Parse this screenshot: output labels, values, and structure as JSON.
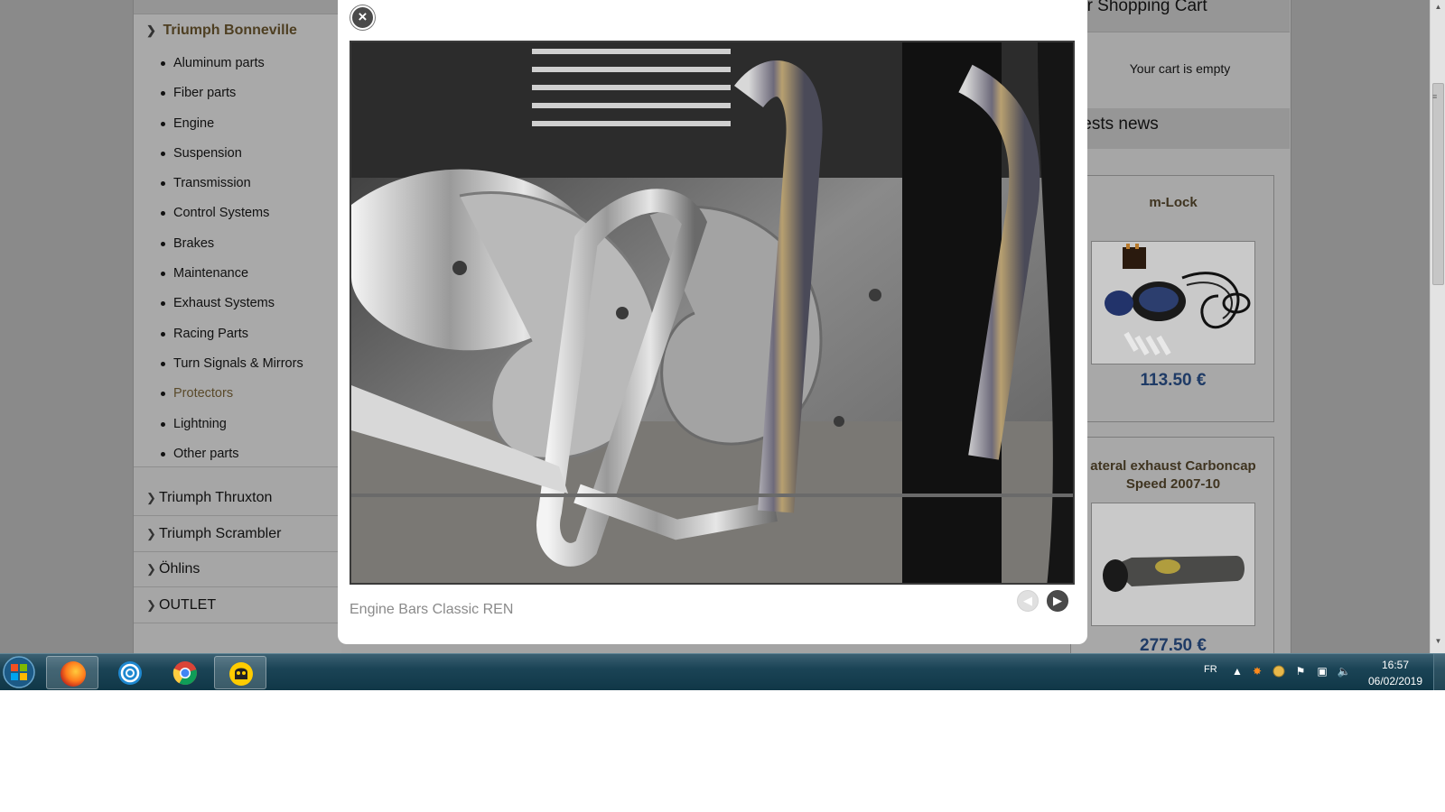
{
  "sidebar": {
    "active_category": "Triumph Bonneville",
    "subcategories": [
      "Aluminum parts",
      "Fiber parts",
      "Engine",
      "Suspension",
      "Transmission",
      "Control Systems",
      "Brakes",
      "Maintenance",
      "Exhaust Systems",
      "Racing Parts",
      "Turn Signals & Mirrors",
      "Protectors",
      "Lightning",
      "Other parts"
    ],
    "active_subcategory": "Protectors",
    "other_categories": [
      "Triumph Thruxton",
      "Triumph Scrambler",
      "Öhlins",
      "OUTLET"
    ]
  },
  "cart": {
    "title": "ur Shopping Cart",
    "empty_text": "Your cart is empty"
  },
  "news": {
    "title": "tests news",
    "products": [
      {
        "name": "m-Lock",
        "price": "113.50 €"
      },
      {
        "name": "ateral exhaust Carboncap Speed 2007-10",
        "price": "277.50 €"
      }
    ]
  },
  "lightbox": {
    "caption": "Engine Bars Classic REN",
    "close_icon": "close-icon",
    "prev_icon": "prev-arrow-icon",
    "next_icon": "next-arrow-icon"
  },
  "taskbar": {
    "apps": [
      "Firefox",
      "Uplay",
      "Chrome",
      "CyberGhost"
    ],
    "language": "FR",
    "time": "16:57",
    "date": "06/02/2019"
  },
  "colors": {
    "overlay": "#8a8a8a",
    "price": "#1f3b66",
    "category_title": "#4e3f22",
    "taskbar": "#103747"
  }
}
